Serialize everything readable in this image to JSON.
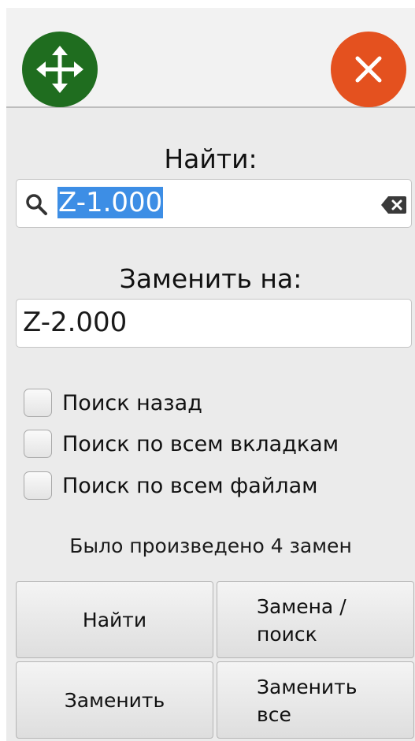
{
  "header": {
    "move_icon": "move-arrows-icon",
    "close_icon": "close-x-icon",
    "colors": {
      "move": "#1f6d1f",
      "close": "#e4511f"
    }
  },
  "find": {
    "label": "Найти:",
    "value": "Z-1.000",
    "search_icon": "search-icon",
    "clear_icon": "backspace-clear-icon"
  },
  "replace": {
    "label": "Заменить на:",
    "value": "Z-2.000"
  },
  "options": [
    {
      "label": "Поиск назад",
      "checked": false
    },
    {
      "label": "Поиск по всем вкладкам",
      "checked": false
    },
    {
      "label": "Поиск по всем файлам",
      "checked": false
    }
  ],
  "status": "Было произведено 4 замен",
  "buttons": {
    "find": "Найти",
    "replace_find_line1": "Замена /",
    "replace_find_line2": "поиск",
    "replace": "Заменить",
    "replace_all_line1": "Заменить",
    "replace_all_line2": "все"
  },
  "selection_color": "#3d8ee5"
}
